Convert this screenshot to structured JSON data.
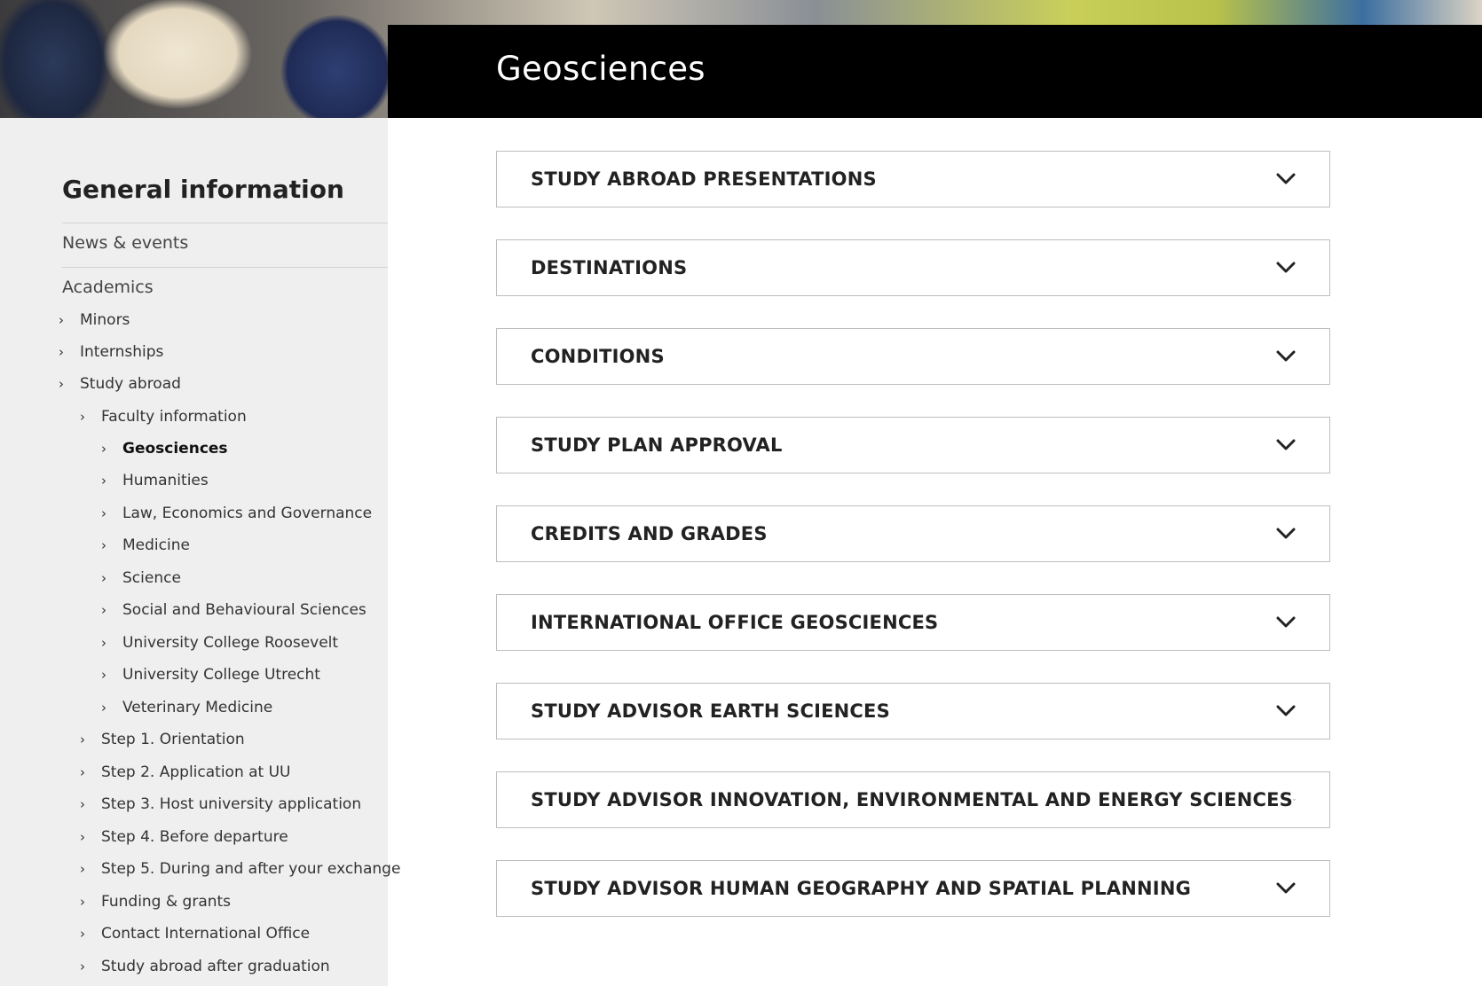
{
  "hero": {
    "title": "Geosciences"
  },
  "sidebar": {
    "heading": "General information",
    "news_label": "News & events",
    "academics_label": "Academics",
    "level1": [
      {
        "label": "Minors"
      },
      {
        "label": "Internships"
      },
      {
        "label": "Study abroad"
      }
    ],
    "faculty_information": {
      "label": "Faculty information"
    },
    "faculties": [
      {
        "label": "Geosciences",
        "active": true
      },
      {
        "label": "Humanities"
      },
      {
        "label": "Law, Economics and Governance"
      },
      {
        "label": "Medicine"
      },
      {
        "label": "Science"
      },
      {
        "label": "Social and Behavioural Sciences"
      },
      {
        "label": "University College Roosevelt"
      },
      {
        "label": "University College Utrecht"
      },
      {
        "label": "Veterinary Medicine"
      }
    ],
    "steps": [
      {
        "label": "Step 1. Orientation"
      },
      {
        "label": "Step 2. Application at UU"
      },
      {
        "label": "Step 3. Host university application"
      },
      {
        "label": "Step 4. Before departure"
      },
      {
        "label": "Step 5. During and after your exchange"
      },
      {
        "label": "Funding & grants"
      },
      {
        "label": "Contact International Office"
      },
      {
        "label": "Study abroad after graduation"
      }
    ]
  },
  "accordion": [
    {
      "label": "STUDY ABROAD PRESENTATIONS"
    },
    {
      "label": "DESTINATIONS"
    },
    {
      "label": "CONDITIONS"
    },
    {
      "label": "STUDY PLAN APPROVAL"
    },
    {
      "label": "CREDITS AND GRADES"
    },
    {
      "label": "INTERNATIONAL OFFICE GEOSCIENCES"
    },
    {
      "label": "STUDY ADVISOR EARTH SCIENCES"
    },
    {
      "label": "STUDY ADVISOR INNOVATION, ENVIRONMENTAL AND ENERGY SCIENCES"
    },
    {
      "label": "STUDY ADVISOR HUMAN GEOGRAPHY AND SPATIAL PLANNING"
    }
  ],
  "icons": {
    "nav_chevron": "chevron-right-icon",
    "accordion_chevron": "chevron-down-icon"
  },
  "colors": {
    "hero_band": "#000000",
    "sidebar_bg": "#efefef",
    "border": "#bdbdbd"
  }
}
